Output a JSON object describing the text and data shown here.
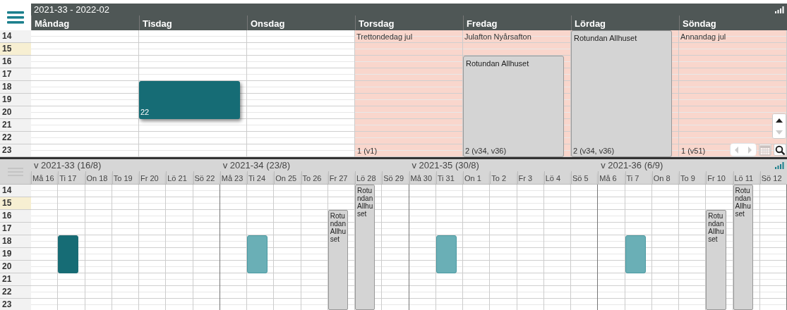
{
  "top": {
    "title": "2021-33 - 2022-02",
    "days": [
      {
        "label": "Måndag",
        "holiday": false
      },
      {
        "label": "Tisdag",
        "holiday": false,
        "events": [
          {
            "kind": "booking",
            "label": "22"
          }
        ]
      },
      {
        "label": "Onsdag",
        "holiday": false
      },
      {
        "label": "Torsdag",
        "holiday": true,
        "holiday_name": "Trettondedag jul",
        "count": "1 (v1)"
      },
      {
        "label": "Fredag",
        "holiday": true,
        "holiday_name": "Julafton Nyårsafton",
        "count": "2 (v34, v36)",
        "events": [
          {
            "kind": "partial-block",
            "label": "Rotundan Allhuset"
          }
        ]
      },
      {
        "label": "Lördag",
        "holiday": true,
        "count": "2 (v34, v36)",
        "events": [
          {
            "kind": "full-block",
            "label": "Rotundan Allhuset"
          }
        ]
      },
      {
        "label": "Söndag",
        "holiday": true,
        "holiday_name": "Annandag jul",
        "count": "1 (v51)"
      }
    ],
    "hours": [
      {
        "label": "14",
        "highlighted": false
      },
      {
        "label": "15",
        "highlighted": true
      },
      {
        "label": "16",
        "highlighted": false
      },
      {
        "label": "17",
        "highlighted": false
      },
      {
        "label": "18",
        "highlighted": false
      },
      {
        "label": "19",
        "highlighted": false
      },
      {
        "label": "20",
        "highlighted": false
      },
      {
        "label": "21",
        "highlighted": false
      },
      {
        "label": "22",
        "highlighted": false
      },
      {
        "label": "23",
        "highlighted": false
      }
    ],
    "controls": [
      {
        "kind": "scroll-up",
        "disabled": false
      },
      {
        "kind": "scroll-down",
        "disabled": true
      },
      {
        "kind": "previous",
        "disabled": true
      },
      {
        "kind": "next",
        "disabled": true
      },
      {
        "kind": "calendar",
        "disabled": true
      },
      {
        "kind": "search",
        "disabled": false
      }
    ]
  },
  "bottom": {
    "weeks": [
      {
        "label": "v 2021-33 (16/8)",
        "days": [
          {
            "label": "Må 16"
          },
          {
            "label": "Ti 17",
            "events": [
              {
                "kind": "booking",
                "selected": true
              }
            ]
          },
          {
            "label": "On 18"
          },
          {
            "label": "To 19"
          },
          {
            "label": "Fr 20"
          },
          {
            "label": "Lö 21"
          },
          {
            "label": "Sö 22"
          }
        ]
      },
      {
        "label": "v 2021-34 (23/8)",
        "days": [
          {
            "label": "Må 23"
          },
          {
            "label": "Ti 24",
            "events": [
              {
                "kind": "booking",
                "selected": false
              }
            ]
          },
          {
            "label": "On 25"
          },
          {
            "label": "To 26"
          },
          {
            "label": "Fr 27",
            "events": [
              {
                "kind": "partial-block",
                "label": "Rotundan Allhuset"
              }
            ]
          },
          {
            "label": "Lö 28",
            "events": [
              {
                "kind": "full-block",
                "label": "Rotundan Allhuset"
              }
            ]
          },
          {
            "label": "Sö 29"
          }
        ]
      },
      {
        "label": "v 2021-35 (30/8)",
        "days": [
          {
            "label": "Må 30"
          },
          {
            "label": "Ti 31",
            "events": [
              {
                "kind": "booking",
                "selected": false
              }
            ]
          },
          {
            "label": "On 1"
          },
          {
            "label": "To 2"
          },
          {
            "label": "Fr 3"
          },
          {
            "label": "Lö 4"
          },
          {
            "label": "Sö 5"
          }
        ]
      },
      {
        "label": "v 2021-36 (6/9)",
        "days": [
          {
            "label": "Må 6"
          },
          {
            "label": "Ti 7",
            "events": [
              {
                "kind": "booking",
                "selected": false
              }
            ]
          },
          {
            "label": "On 8"
          },
          {
            "label": "To 9"
          },
          {
            "label": "Fr 10",
            "events": [
              {
                "kind": "partial-block",
                "label": "Rotundan Allhuset"
              }
            ]
          },
          {
            "label": "Lö 11",
            "events": [
              {
                "kind": "full-block",
                "label": "Rotundan Allhuset"
              }
            ]
          },
          {
            "label": "Sö 12"
          }
        ]
      }
    ],
    "hours": [
      {
        "label": "14",
        "highlighted": false
      },
      {
        "label": "15",
        "highlighted": true
      },
      {
        "label": "16",
        "highlighted": false
      },
      {
        "label": "17",
        "highlighted": false
      },
      {
        "label": "18",
        "highlighted": false
      },
      {
        "label": "19",
        "highlighted": false
      },
      {
        "label": "20",
        "highlighted": false
      },
      {
        "label": "21",
        "highlighted": false
      },
      {
        "label": "22",
        "highlighted": false
      },
      {
        "label": "23",
        "highlighted": false
      }
    ]
  }
}
